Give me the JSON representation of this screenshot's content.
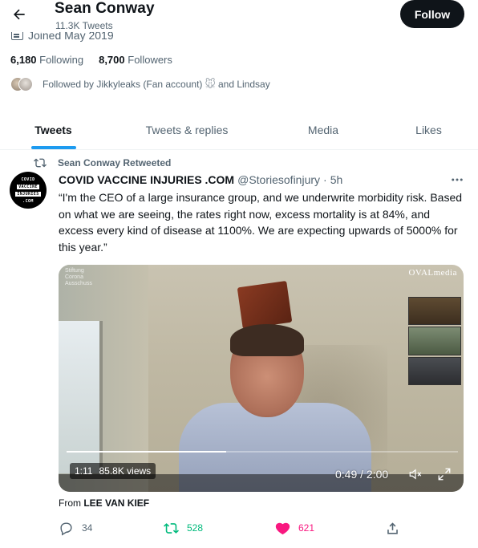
{
  "header": {
    "name": "Sean Conway",
    "tweet_count": "11.3K Tweets",
    "follow_label": "Follow"
  },
  "profile": {
    "joined": "Joined May 2019",
    "following_count": "6,180",
    "following_label": "Following",
    "followers_count": "8,700",
    "followers_label": "Followers",
    "followed_by_prefix": "Followed by Jikkyleaks (Fan account)",
    "followed_by_suffix": "and Lindsay"
  },
  "tabs": [
    {
      "label": "Tweets",
      "active": true
    },
    {
      "label": "Tweets & replies",
      "active": false
    },
    {
      "label": "Media",
      "active": false
    },
    {
      "label": "Likes",
      "active": false
    }
  ],
  "tweet": {
    "retweet_label": "Sean Conway Retweeted",
    "avatar_lines": [
      "COVID",
      "VACCINE",
      "INJURIES",
      ".COM"
    ],
    "author_name": "COVID VACCINE INJURIES .COM",
    "handle": "@Storiesofinjury",
    "separator": "·",
    "time": "5h",
    "text": "“I'm the CEO of a large insurance group, and we underwrite morbidity risk. Based on what we are seeing, the rates right now, excess mortality is at 84%, and excess every kind of disease at 1100%. We are expecting upwards of 5000% for this year.”",
    "video": {
      "duration_badge": "1:11",
      "views": "85.8K views",
      "time_display": "0:49 / 2:00",
      "progress": 0.408,
      "logo": "OVALmedia",
      "corner_text": [
        "Stiftung",
        "Corona",
        "Ausschuss"
      ]
    },
    "from_prefix": "From",
    "from_source": "LEE VAN KIEF",
    "reply_count": "34",
    "retweet_count": "528",
    "like_count": "621",
    "colors": {
      "retweet_green": "#00ba7c",
      "like_pink": "#f91880",
      "accent_blue": "#1d9bf0"
    }
  }
}
